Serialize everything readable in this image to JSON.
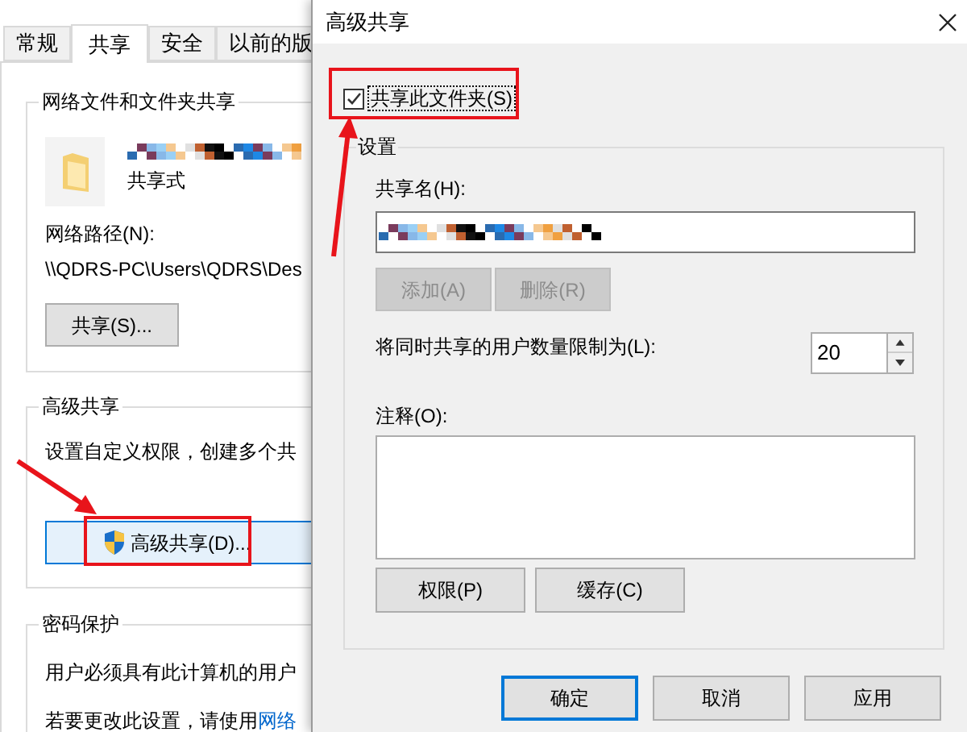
{
  "properties_window": {
    "tabs": [
      {
        "label": "常规",
        "selected": false
      },
      {
        "label": "共享",
        "selected": true
      },
      {
        "label": "安全",
        "selected": false
      },
      {
        "label": "以前的版",
        "selected": false
      }
    ],
    "network_sharing": {
      "title": "网络文件和文件夹共享",
      "folder_status": "共享式",
      "path_label": "网络路径(N):",
      "path": "\\\\QDRS-PC\\Users\\QDRS\\Des",
      "share_button": "共享(S)..."
    },
    "advanced_sharing": {
      "title": "高级共享",
      "description": "设置自定义权限，创建多个共",
      "button": "高级共享(D)..."
    },
    "password_protection": {
      "title": "密码保护",
      "description": "用户必须具有此计算机的用户",
      "note": "若要更改此设置，请使用",
      "link": "网络"
    }
  },
  "dialog": {
    "title": "高级共享",
    "share_checkbox": {
      "label": "共享此文件夹(S)",
      "checked": true
    },
    "settings": {
      "title": "设置",
      "share_name_label": "共享名(H):",
      "add_button": {
        "label": "添加(A)",
        "disabled": true
      },
      "remove_button": {
        "label": "删除(R)",
        "disabled": true
      },
      "limit_label": "将同时共享的用户数量限制为(L):",
      "limit_value": "20",
      "comment_label": "注释(O):",
      "permissions_button": "权限(P)",
      "cache_button": "缓存(C)"
    },
    "buttons": [
      {
        "label": "确定",
        "default": true
      },
      {
        "label": "取消",
        "default": false
      },
      {
        "label": "应用",
        "default": false
      }
    ]
  }
}
